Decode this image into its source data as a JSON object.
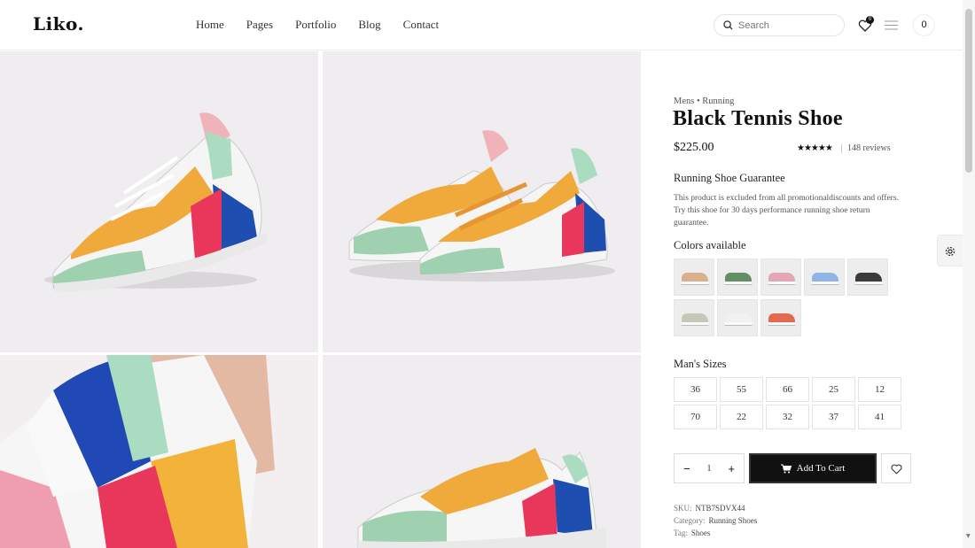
{
  "header": {
    "logo": "Liko.",
    "nav": [
      "Home",
      "Pages",
      "Portfolio",
      "Blog",
      "Contact"
    ],
    "search_placeholder": "Search",
    "wishlist_count": "0",
    "cart_count": "0"
  },
  "product": {
    "category_1": "Mens",
    "category_2": "Running",
    "category_line": "Mens • Running",
    "title": "Black Tennis Shoe",
    "price": "$225.00",
    "rating": 5,
    "stars": "★★★★★",
    "reviews": "148 reviews",
    "guarantee_title": "Running Shoe Guarantee",
    "guarantee_text": "This product is excluded from all promotionaldiscounts and offers. Try this shoe for 30 days performance running shoe return guarantee.",
    "colors_title": "Colors available",
    "colors": [
      "#d9b08c",
      "#5f8f62",
      "#e3a6b4",
      "#8fb4e6",
      "#3b3b3b",
      "#c6c8b7",
      "#f1f1f1",
      "#e36a4f"
    ],
    "sizes_title": "Man's Sizes",
    "sizes": [
      "36",
      "55",
      "66",
      "25",
      "12",
      "70",
      "22",
      "32",
      "37",
      "41"
    ],
    "quantity": "1",
    "minus": "−",
    "plus": "+",
    "add_to_cart": "Add To Cart",
    "sku_label": "SKU:",
    "sku": "NTB7SDVX44",
    "category_label": "Category:",
    "category": "Running Shoes",
    "tag_label": "Tag:",
    "tag": "Shoes"
  }
}
